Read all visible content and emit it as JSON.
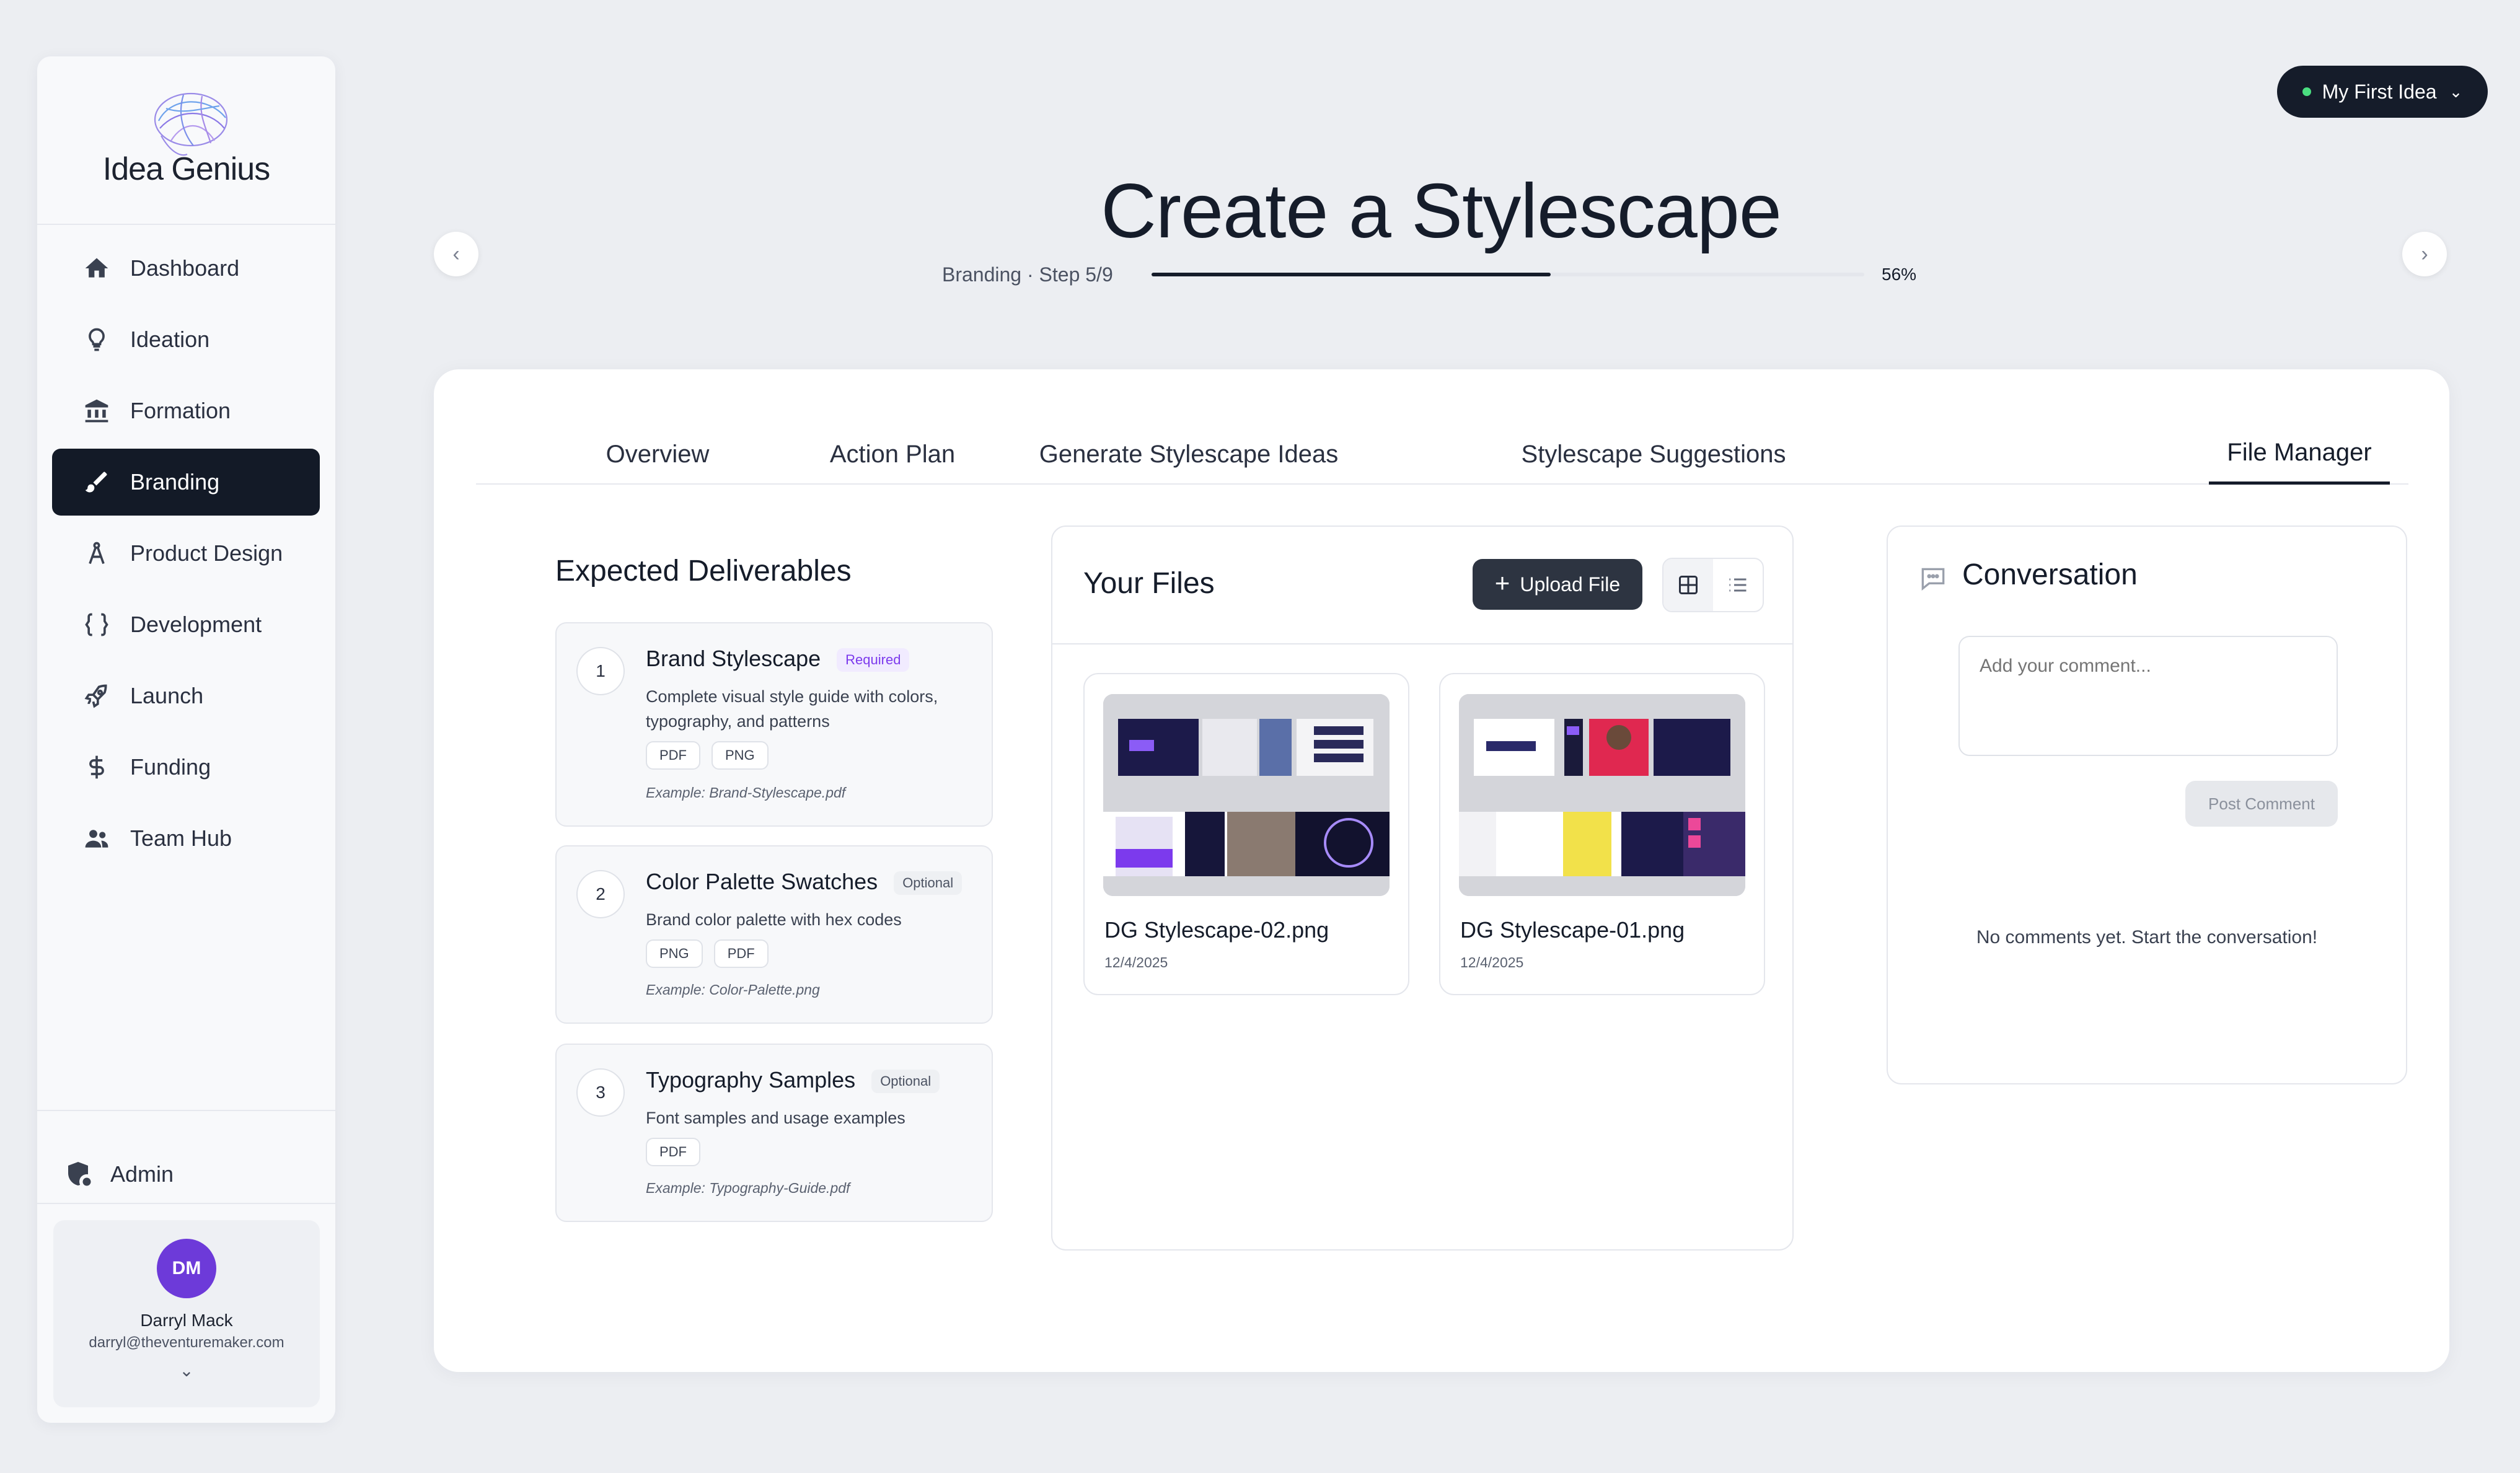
{
  "app": {
    "name": "Idea Genius"
  },
  "sidebar": {
    "items": [
      {
        "label": "Dashboard",
        "icon": "home-icon",
        "active": false
      },
      {
        "label": "Ideation",
        "icon": "lightbulb-icon",
        "active": false
      },
      {
        "label": "Formation",
        "icon": "bank-icon",
        "active": false
      },
      {
        "label": "Branding",
        "icon": "brush-icon",
        "active": true
      },
      {
        "label": "Product Design",
        "icon": "compass-icon",
        "active": false
      },
      {
        "label": "Development",
        "icon": "code-braces-icon",
        "active": false
      },
      {
        "label": "Launch",
        "icon": "rocket-icon",
        "active": false
      },
      {
        "label": "Funding",
        "icon": "dollar-icon",
        "active": false
      },
      {
        "label": "Team Hub",
        "icon": "people-icon",
        "active": false
      }
    ],
    "admin_label": "Admin",
    "user": {
      "initials": "DM",
      "name": "Darryl Mack",
      "email": "darryl@theventuremaker.com"
    }
  },
  "header": {
    "idea_selector": "My First Idea",
    "title": "Create a Stylescape",
    "step_label": "Branding · Step 5/9",
    "progress_percent": 56,
    "progress_label": "56%"
  },
  "tabs": [
    {
      "label": "Overview",
      "active": false
    },
    {
      "label": "Action Plan",
      "active": false
    },
    {
      "label": "Generate Stylescape Ideas",
      "active": false
    },
    {
      "label": "Stylescape Suggestions",
      "active": false
    },
    {
      "label": "File Manager",
      "active": true
    }
  ],
  "deliverables": {
    "title": "Expected Deliverables",
    "items": [
      {
        "num": "1",
        "name": "Brand Stylescape",
        "badge": "Required",
        "desc": "Complete visual style guide with colors, typography, and patterns",
        "formats": [
          "PDF",
          "PNG"
        ],
        "example": "Example: Brand-Stylescape.pdf"
      },
      {
        "num": "2",
        "name": "Color Palette Swatches",
        "badge": "Optional",
        "desc": "Brand color palette with hex codes",
        "formats": [
          "PNG",
          "PDF"
        ],
        "example": "Example: Color-Palette.png"
      },
      {
        "num": "3",
        "name": "Typography Samples",
        "badge": "Optional",
        "desc": "Font samples and usage examples",
        "formats": [
          "PDF"
        ],
        "example": "Example: Typography-Guide.pdf"
      }
    ]
  },
  "files": {
    "title": "Your Files",
    "upload_label": "Upload File",
    "items": [
      {
        "name": "DG Stylescape-02.png",
        "date": "12/4/2025"
      },
      {
        "name": "DG Stylescape-01.png",
        "date": "12/4/2025"
      }
    ]
  },
  "conversation": {
    "title": "Conversation",
    "placeholder": "Add your comment...",
    "post_label": "Post Comment",
    "empty_text": "No comments yet. Start the conversation!"
  },
  "colors": {
    "accent_dark": "#151c2a",
    "brand_purple": "#6d3ad9",
    "status_green": "#4ade80"
  }
}
